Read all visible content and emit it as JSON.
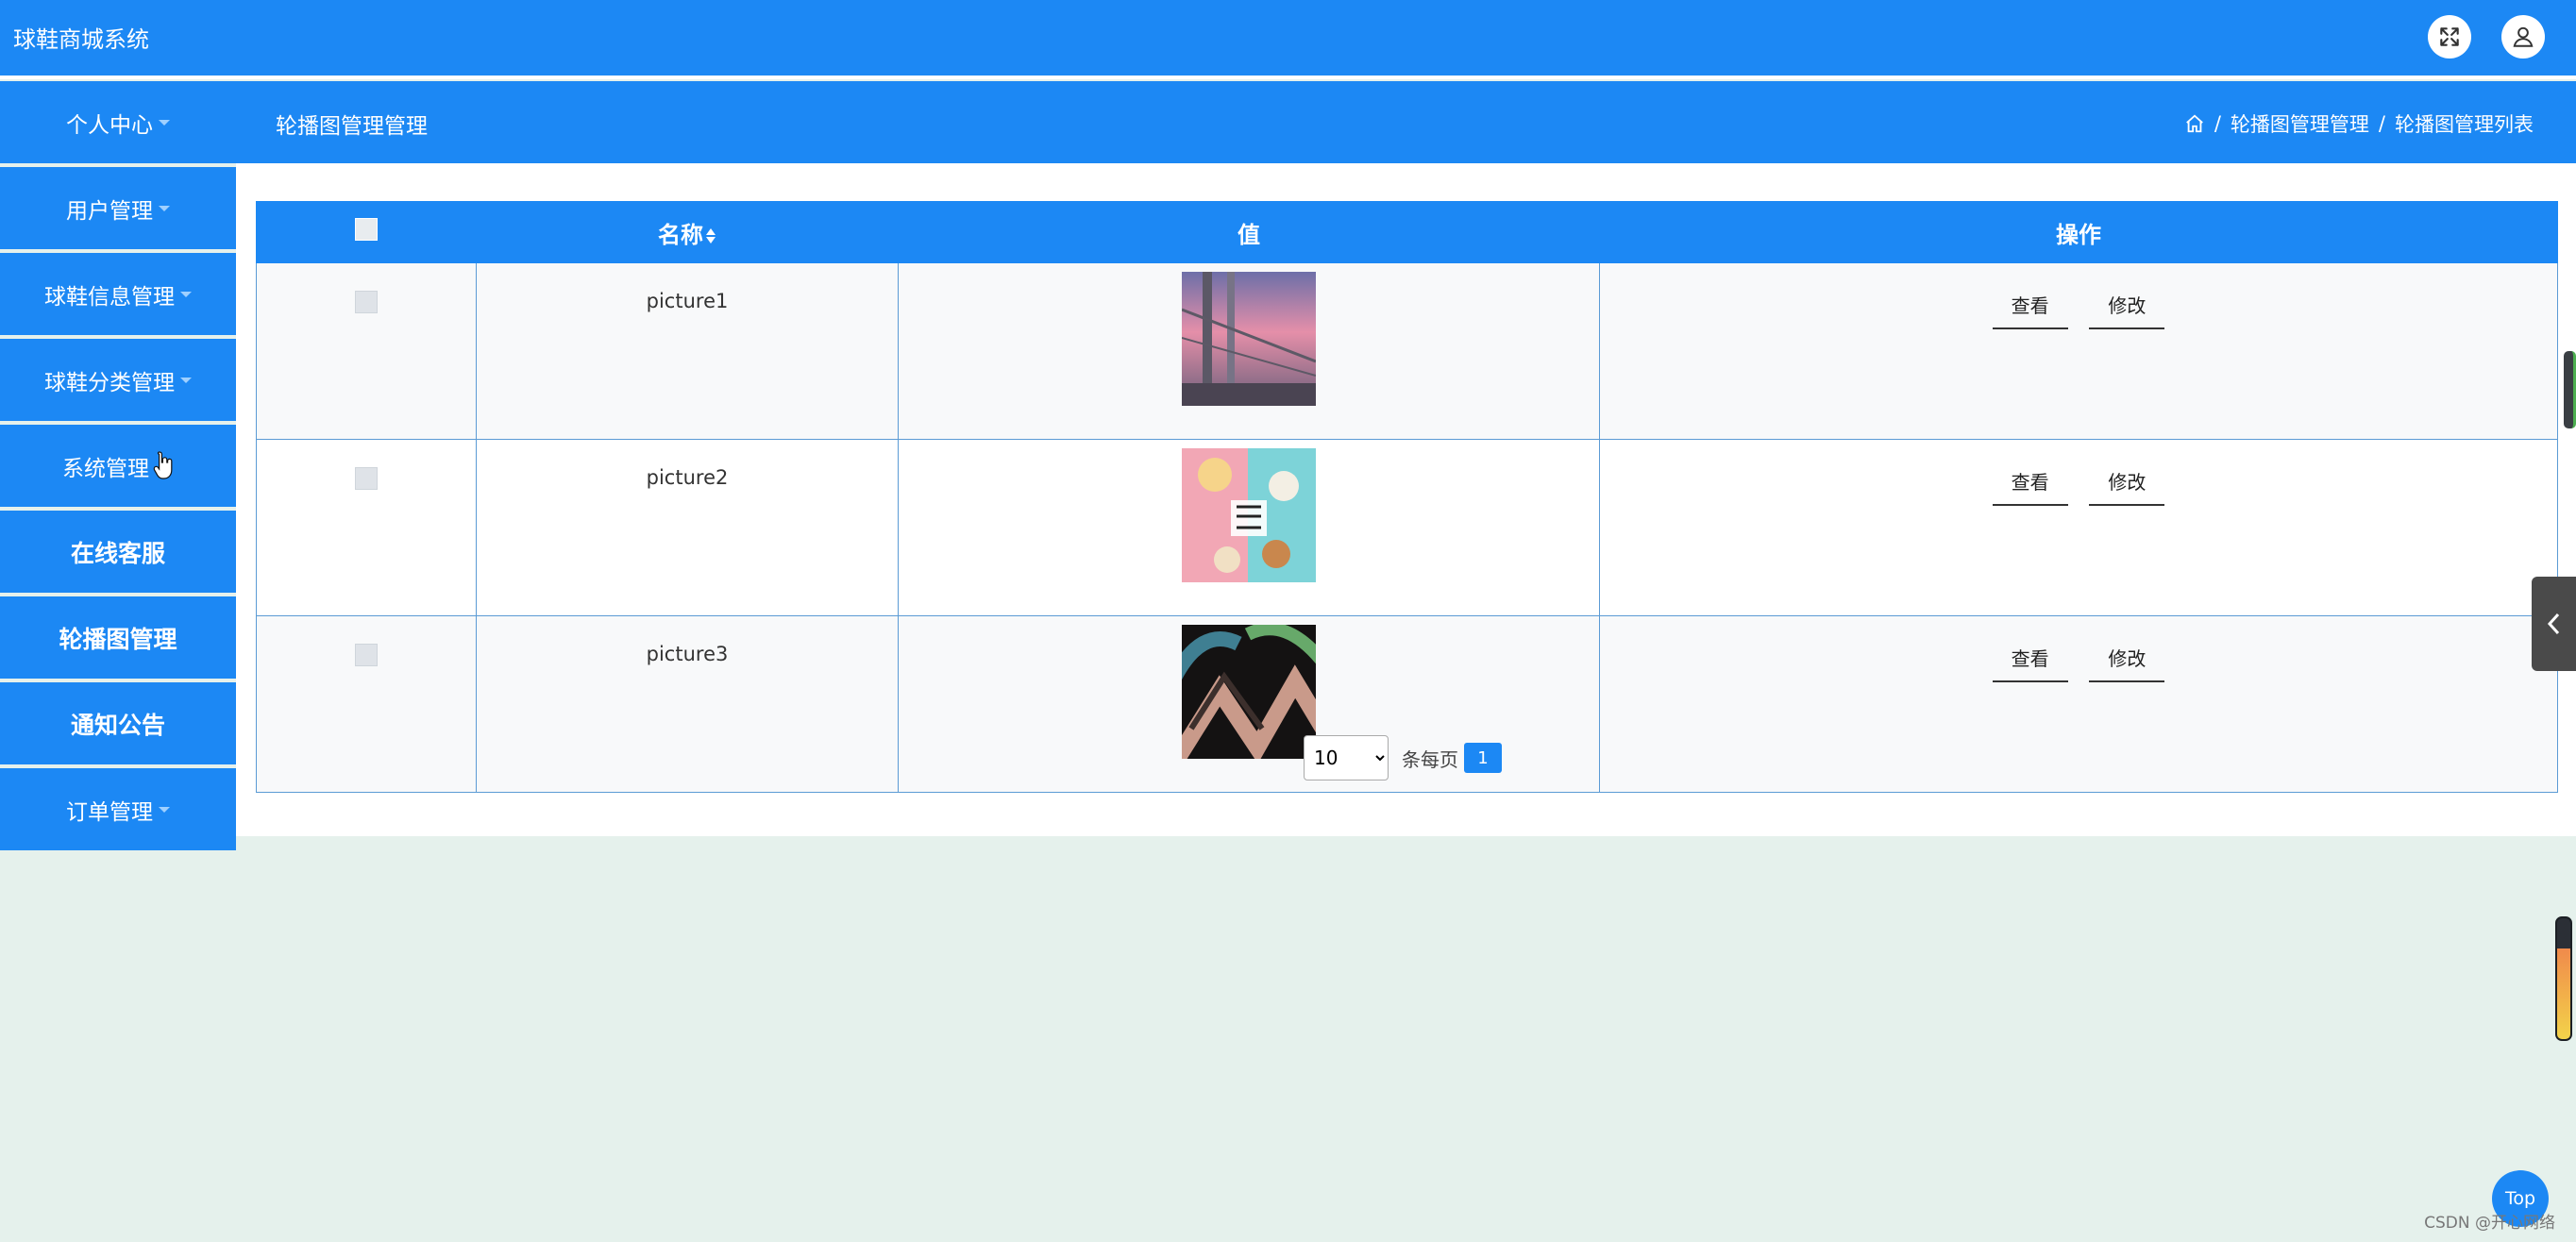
{
  "header": {
    "app_title": "球鞋商城系统",
    "fullscreen_icon": "fullscreen-icon",
    "user_icon": "user-icon"
  },
  "sidebar": {
    "items": [
      {
        "label": "个人中心",
        "has_caret": true
      },
      {
        "label": "用户管理",
        "has_caret": true
      },
      {
        "label": "球鞋信息管理",
        "has_caret": true
      },
      {
        "label": "球鞋分类管理",
        "has_caret": true
      },
      {
        "label": "系统管理",
        "has_caret": false
      },
      {
        "label": "在线客服",
        "has_caret": false
      },
      {
        "label": "轮播图管理",
        "has_caret": false
      },
      {
        "label": "通知公告",
        "has_caret": false
      },
      {
        "label": "订单管理",
        "has_caret": true
      }
    ]
  },
  "subheader": {
    "title": "轮播图管理管理",
    "breadcrumb": [
      "轮播图管理管理",
      "轮播图管理列表"
    ],
    "separator": "/"
  },
  "table": {
    "columns": {
      "select": "",
      "name": "名称",
      "value": "值",
      "actions": "操作"
    },
    "rows": [
      {
        "name": "picture1",
        "image": "bridge-sunset-photo"
      },
      {
        "name": "picture2",
        "image": "pastel-food-photo"
      },
      {
        "name": "picture3",
        "image": "dark-abstract-stripes"
      }
    ],
    "view_label": "查看",
    "edit_label": "修改"
  },
  "pagination": {
    "page_size": "10",
    "page_size_options": [
      "10"
    ],
    "per_page_label": "条每页",
    "current_page": "1"
  },
  "widgets": {
    "top_button": "Top",
    "watermark": "CSDN @开心网络"
  },
  "colors": {
    "primary": "#1c88f4",
    "background": "#e5f1ec"
  }
}
